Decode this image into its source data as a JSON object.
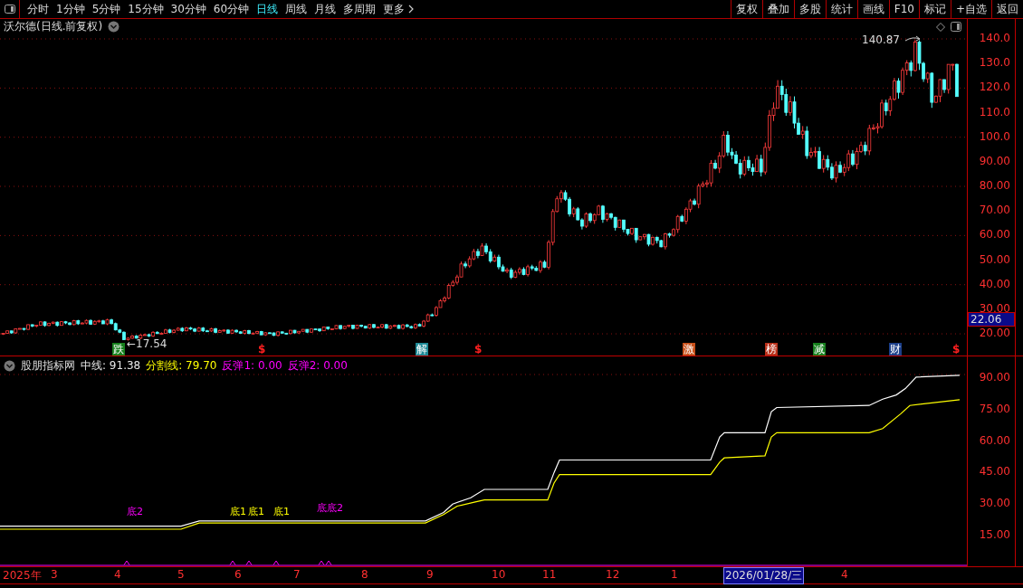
{
  "toolbar": {
    "periods": [
      {
        "label": "分时",
        "selected": false
      },
      {
        "label": "1分钟",
        "selected": false
      },
      {
        "label": "5分钟",
        "selected": false
      },
      {
        "label": "15分钟",
        "selected": false
      },
      {
        "label": "30分钟",
        "selected": false
      },
      {
        "label": "60分钟",
        "selected": false
      },
      {
        "label": "日线",
        "selected": true
      },
      {
        "label": "周线",
        "selected": false
      },
      {
        "label": "月线",
        "selected": false
      },
      {
        "label": "多周期",
        "selected": false
      },
      {
        "label": "更多",
        "selected": false
      }
    ],
    "actions": [
      "复权",
      "叠加",
      "多股",
      "统计",
      "画线",
      "F10",
      "标记",
      "+自选",
      "返回"
    ]
  },
  "main_chart": {
    "title": "沃尔德(日线.前复权)",
    "y_axis_labels": [
      "140.0",
      "130.0",
      "120.0",
      "110.0",
      "100.0",
      "90.00",
      "80.00",
      "70.00",
      "60.00",
      "50.00",
      "40.00",
      "30.00",
      "20.00"
    ],
    "current_price": "22.06",
    "high_label": "140.87",
    "low_label": "←17.54",
    "signals": [
      {
        "text": "跌",
        "kind": "tag",
        "color": "#17801e"
      },
      {
        "text": "$",
        "kind": "sign",
        "color": "#ff2020"
      },
      {
        "text": "解",
        "kind": "tag",
        "color": "#1f8a96"
      },
      {
        "text": "$",
        "kind": "sign",
        "color": "#ff2020"
      },
      {
        "text": "激",
        "kind": "tag",
        "color": "#c8501a"
      },
      {
        "text": "榜",
        "kind": "tag",
        "color": "#b8301a"
      },
      {
        "text": "减",
        "kind": "tag",
        "color": "#17801e"
      },
      {
        "text": "财",
        "kind": "tag",
        "color": "#1c3f8a"
      },
      {
        "text": "$",
        "kind": "sign",
        "color": "#ff2020"
      }
    ]
  },
  "indicator": {
    "name": "股朋指标网",
    "values": [
      {
        "text": "中线: 91.38",
        "color": "#e8e8e8"
      },
      {
        "text": "分割线: 79.70",
        "color": "#ffff00"
      },
      {
        "text": "反弹1: 0.00",
        "color": "#ff00ff"
      },
      {
        "text": "反弹2: 0.00",
        "color": "#ff00ff"
      }
    ],
    "y_axis_labels": [
      "90.00",
      "75.00",
      "60.00",
      "45.00",
      "30.00",
      "15.00"
    ],
    "signals": [
      {
        "text": "底2",
        "color": "#ff00ff"
      },
      {
        "text": "底1",
        "color": "#ffff00"
      },
      {
        "text": "底1",
        "color": "#ffff00"
      },
      {
        "text": "底1",
        "color": "#ffff00"
      },
      {
        "text": "底底2",
        "color": "#ff00ff"
      }
    ]
  },
  "date_axis": [
    {
      "label": "2025年",
      "highlighted": false
    },
    {
      "label": "3",
      "highlighted": false
    },
    {
      "label": "4",
      "highlighted": false
    },
    {
      "label": "5",
      "highlighted": false
    },
    {
      "label": "6",
      "highlighted": false
    },
    {
      "label": "7",
      "highlighted": false
    },
    {
      "label": "8",
      "highlighted": false
    },
    {
      "label": "9",
      "highlighted": false
    },
    {
      "label": "10",
      "highlighted": false
    },
    {
      "label": "11",
      "highlighted": false
    },
    {
      "label": "12",
      "highlighted": false
    },
    {
      "label": "1",
      "highlighted": false
    },
    {
      "label": "2026/01/28/三",
      "highlighted": true
    },
    {
      "label": "4",
      "highlighted": false
    }
  ]
}
